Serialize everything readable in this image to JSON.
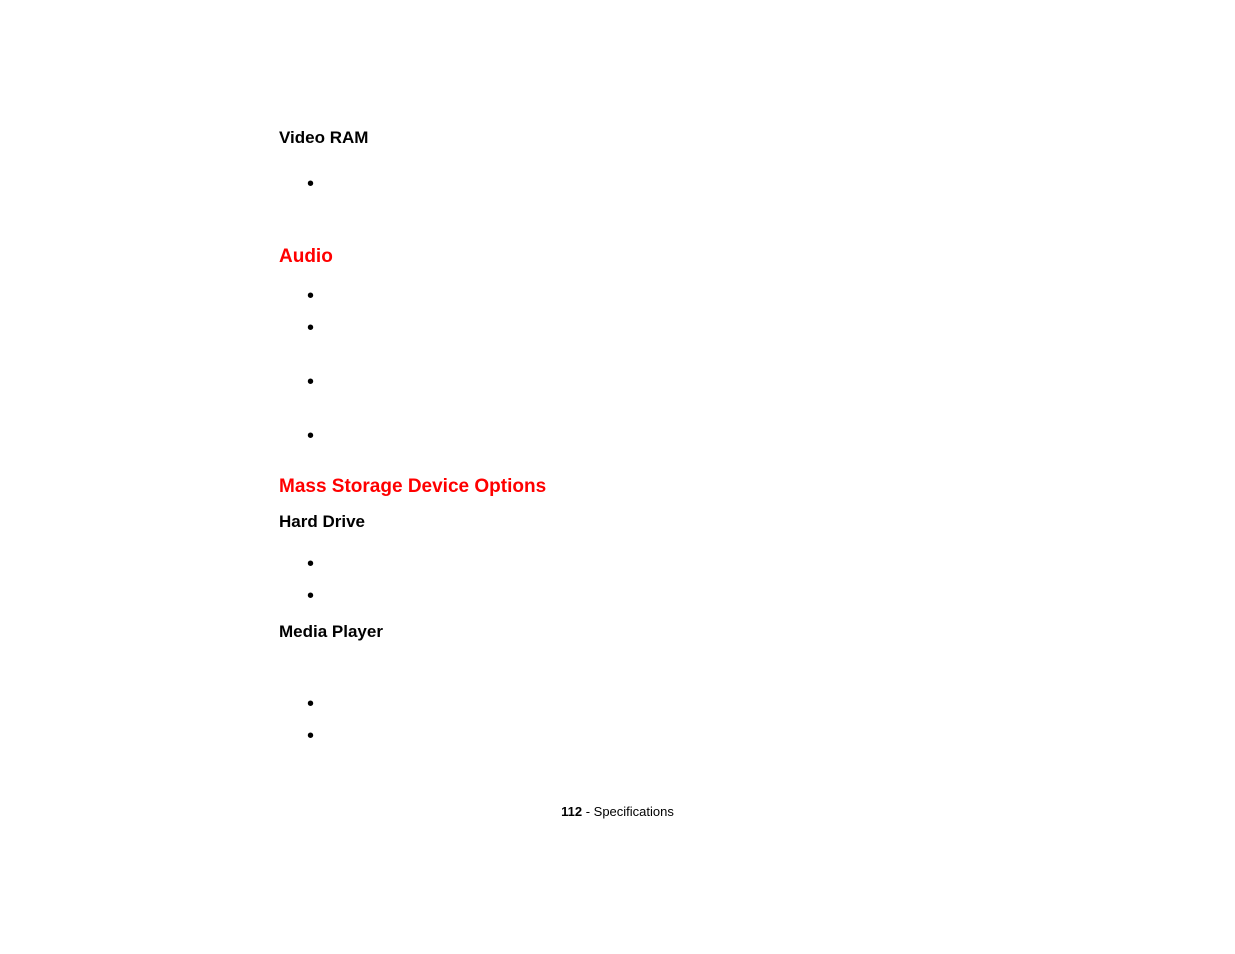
{
  "sections": {
    "video_ram_heading": "Video RAM",
    "audio_heading": "Audio",
    "mass_storage_heading": "Mass Storage Device Options",
    "hard_drive_heading": "Hard Drive",
    "media_player_heading": "Media Player"
  },
  "bullet": "•",
  "footer": {
    "page_number": "112",
    "separator": " - ",
    "title": "Specifications"
  }
}
